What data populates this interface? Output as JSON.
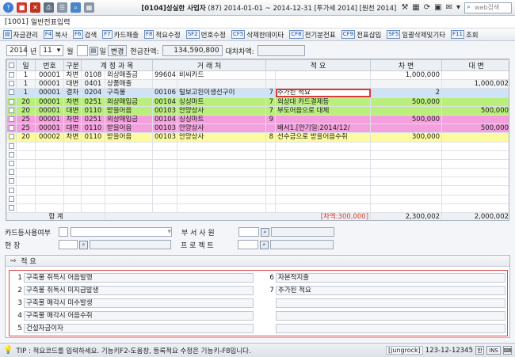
{
  "titlebar": {
    "company": "[0104]성실한 사업자",
    "period": "(87) 2014-01-01 ~ 2014-12-31",
    "user": "[투가세 2014]",
    "db": "[원천 2014]",
    "search_placeholder": "web검색"
  },
  "window": {
    "code": "[1001]",
    "title": "일반전표입력"
  },
  "toolbar": [
    {
      "key": "",
      "label": "자금관리"
    },
    {
      "key": "F4",
      "label": "복사"
    },
    {
      "key": "F6",
      "label": "검색"
    },
    {
      "key": "F7",
      "label": "카드매출"
    },
    {
      "key": "F8",
      "label": "적요수정"
    },
    {
      "key": "SF2",
      "label": "번호수정"
    },
    {
      "key": "CF5",
      "label": "삭제한데이타"
    },
    {
      "key": "CF8",
      "label": "전기분전표"
    },
    {
      "key": "CF9",
      "label": "전표삽입"
    },
    {
      "key": "SF5",
      "label": "일괄삭제및기타"
    },
    {
      "key": "F11",
      "label": "조회"
    }
  ],
  "filter": {
    "year": "2014",
    "year_unit": "년",
    "month": "11",
    "month_unit": "월",
    "day_label": "일",
    "change_btn": "변경",
    "cash_label": "현금잔액:",
    "cash_value": "134,590,800",
    "diff_label": "대차차액:",
    "diff_value": ""
  },
  "grid": {
    "headers": [
      "일",
      "번호",
      "구분",
      "계 정 과 목",
      "",
      "거 래 처",
      "",
      "적 요",
      "차 변",
      "대 변"
    ],
    "rows": [
      {
        "style": "white",
        "day": "1",
        "no": "00001",
        "type": "차변",
        "acct_code": "0108",
        "acct": "외상매출금",
        "cust_code": "99604",
        "cust": "비씨카드",
        "memo_no": "",
        "memo": "",
        "debit": "1,000,000",
        "credit": ""
      },
      {
        "style": "grey",
        "day": "1",
        "no": "00001",
        "type": "대변",
        "acct_code": "0401",
        "acct": "상품매출",
        "cust_code": "",
        "cust": "",
        "memo_no": "",
        "memo": "",
        "debit": "",
        "credit": "1,000,002"
      },
      {
        "style": "sel",
        "day": "1",
        "no": "00001",
        "type": "결차",
        "acct_code": "0204",
        "acct": "구축물",
        "cust_code": "00106",
        "cust": "털보고된이생선구이",
        "memo_no": "7",
        "memo": "추가된 적요",
        "debit": "2",
        "credit": ""
      },
      {
        "style": "green",
        "day": "20",
        "no": "00001",
        "type": "차변",
        "acct_code": "0251",
        "acct": "외상매입금",
        "cust_code": "00104",
        "cust": "싱싱마트",
        "memo_no": "7",
        "memo": "외상대 카드결제등",
        "debit": "500,000",
        "credit": ""
      },
      {
        "style": "green",
        "day": "20",
        "no": "00001",
        "type": "대변",
        "acct_code": "0110",
        "acct": "받을어음",
        "cust_code": "00103",
        "cust": "안양상사",
        "memo_no": "7",
        "memo": "부도어음으로 대체",
        "debit": "",
        "credit": "500,000"
      },
      {
        "style": "pink",
        "day": "25",
        "no": "00001",
        "type": "차변",
        "acct_code": "0251",
        "acct": "외상매입금",
        "cust_code": "00104",
        "cust": "싱싱마트",
        "memo_no": "9",
        "memo": "",
        "debit": "500,000",
        "credit": ""
      },
      {
        "style": "pink",
        "day": "25",
        "no": "00001",
        "type": "대변",
        "acct_code": "0110",
        "acct": "받을어음",
        "cust_code": "00103",
        "cust": "안양상사",
        "memo_no": "",
        "memo": "배서1.[만기일:2014/12/",
        "debit": "",
        "credit": "500,000"
      },
      {
        "style": "yellow",
        "day": "20",
        "no": "00002",
        "type": "차변",
        "acct_code": "0110",
        "acct": "받을어음",
        "cust_code": "00103",
        "cust": "안양상사",
        "memo_no": "8",
        "memo": "선수금으로 받을어음수취",
        "debit": "300,000",
        "credit": ""
      }
    ],
    "empty_rows": 8,
    "total": {
      "label": "합 계",
      "diff_note": "[차액:300,000]",
      "debit": "2,300,002",
      "credit": "2,000,002"
    }
  },
  "form": {
    "card_label": "카드등사용여부",
    "dept_label": "부 서 사 원",
    "site_label": "현 장",
    "project_label": "프 로 젝 트"
  },
  "memo": {
    "title": "적 요",
    "left": [
      {
        "no": "1",
        "text": "구축물 취득시 어음발행"
      },
      {
        "no": "2",
        "text": "구축물 취득시 미지급발생"
      },
      {
        "no": "3",
        "text": "구축물 매각시 미수발생"
      },
      {
        "no": "4",
        "text": "구축물 매각시 어음수취"
      },
      {
        "no": "5",
        "text": "건설자금이자"
      }
    ],
    "right": [
      {
        "no": "6",
        "text": "자본적지출"
      },
      {
        "no": "7",
        "text": "추가된 적요"
      },
      {
        "no": "",
        "text": ""
      },
      {
        "no": "",
        "text": ""
      },
      {
        "no": "",
        "text": ""
      }
    ]
  },
  "status": {
    "tip": "TIP : 적요코드를 입력하세요. 기능키F2-도움창, 등록적요 수정은 기능키-F8입니다.",
    "user": "[jungrock]",
    "build": "123-12-12345",
    "mode": "한",
    "ins": "INS"
  }
}
